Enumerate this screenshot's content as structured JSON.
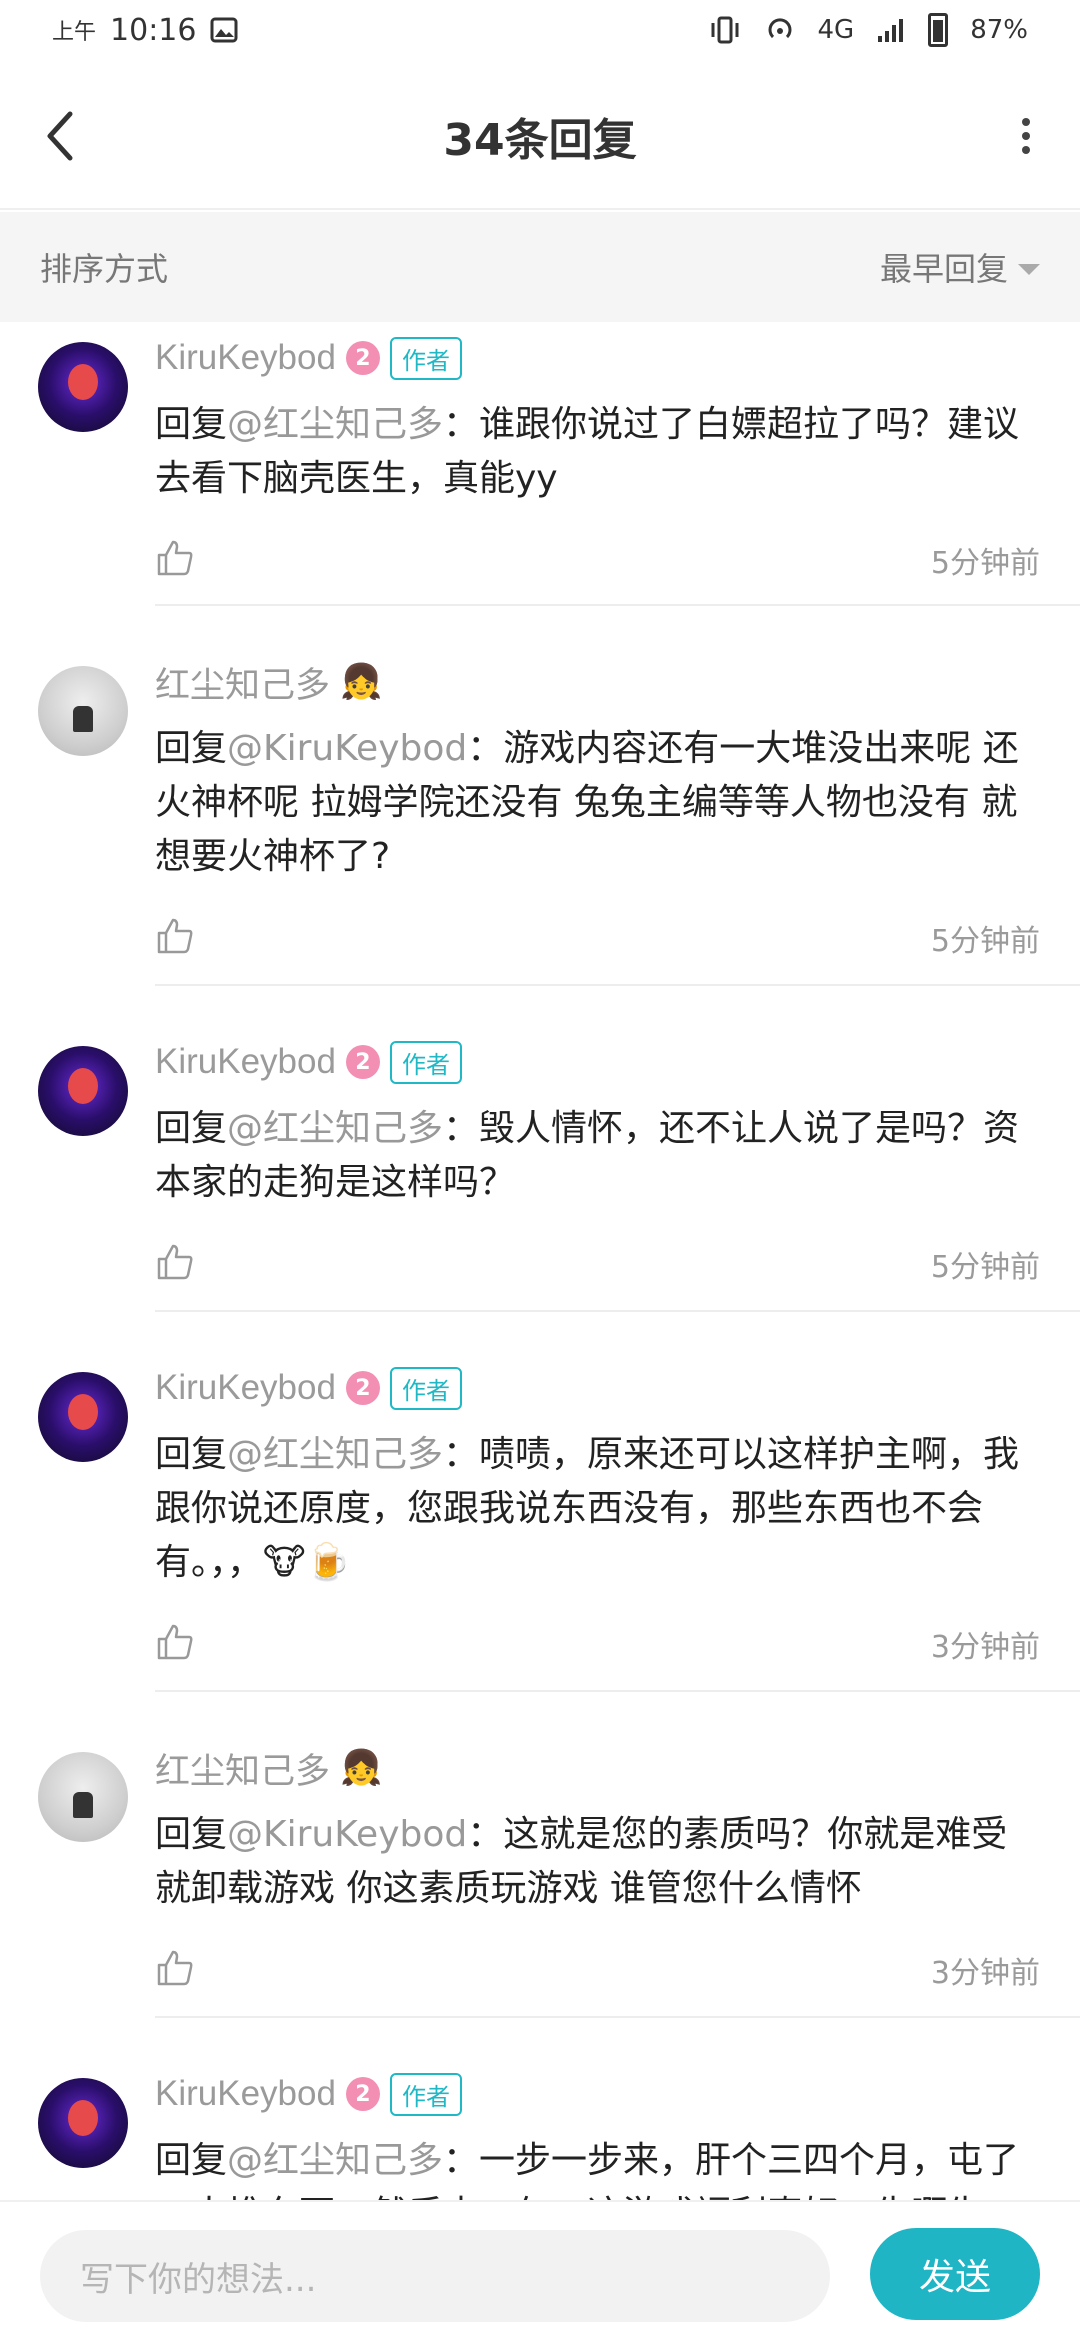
{
  "status_bar": {
    "time_prefix": "上午",
    "time": "10:16",
    "network": "4G",
    "battery": "87%"
  },
  "header": {
    "title": "34条回复"
  },
  "sort": {
    "label": "排序方式",
    "value": "最早回复"
  },
  "comments": [
    {
      "user": "KiruKeybod",
      "level": "2",
      "author_tag": "作者",
      "prefix": "回复",
      "mention": "@红尘知己多",
      "text": "：谁跟你说过了白嫖超拉了吗？建议去看下脑壳医生，真能yy",
      "time": "5分钟前"
    },
    {
      "user": "红尘知己多",
      "badge_emoji": "👧",
      "prefix": "回复",
      "mention": "@KiruKeybod",
      "text": "：游戏内容还有一大堆没出来呢 还火神杯呢 拉姆学院还没有 兔兔主编等等人物也没有 就想要火神杯了?",
      "time": "5分钟前"
    },
    {
      "user": "KiruKeybod",
      "level": "2",
      "author_tag": "作者",
      "prefix": "回复",
      "mention": "@红尘知己多",
      "text": "：毁人情怀，还不让人说了是吗？资本家的走狗是这样吗？",
      "time": "5分钟前"
    },
    {
      "user": "KiruKeybod",
      "level": "2",
      "author_tag": "作者",
      "prefix": "回复",
      "mention": "@红尘知己多",
      "text": "：啧啧，原来还可以这样护主啊，我跟你说还原度，您跟我说东西没有，那些东西也不会有。，，🐮🍺",
      "time": "3分钟前"
    },
    {
      "user": "红尘知己多",
      "badge_emoji": "👧",
      "prefix": "回复",
      "mention": "@KiruKeybod",
      "text": "：这就是您的素质吗？你就是难受就卸载游戏 你这素质玩游戏 谁管您什么情怀",
      "time": "3分钟前"
    },
    {
      "user": "KiruKeybod",
      "level": "2",
      "author_tag": "作者",
      "prefix": "回复",
      "mention": "@红尘知己多",
      "text": "：一步一步来，肝个三四个月，屯了一大堆东西，然后来一句，这游戏福利真好，生啊生",
      "time": ""
    }
  ],
  "composer": {
    "placeholder": "写下你的想法...",
    "send_label": "发送"
  }
}
